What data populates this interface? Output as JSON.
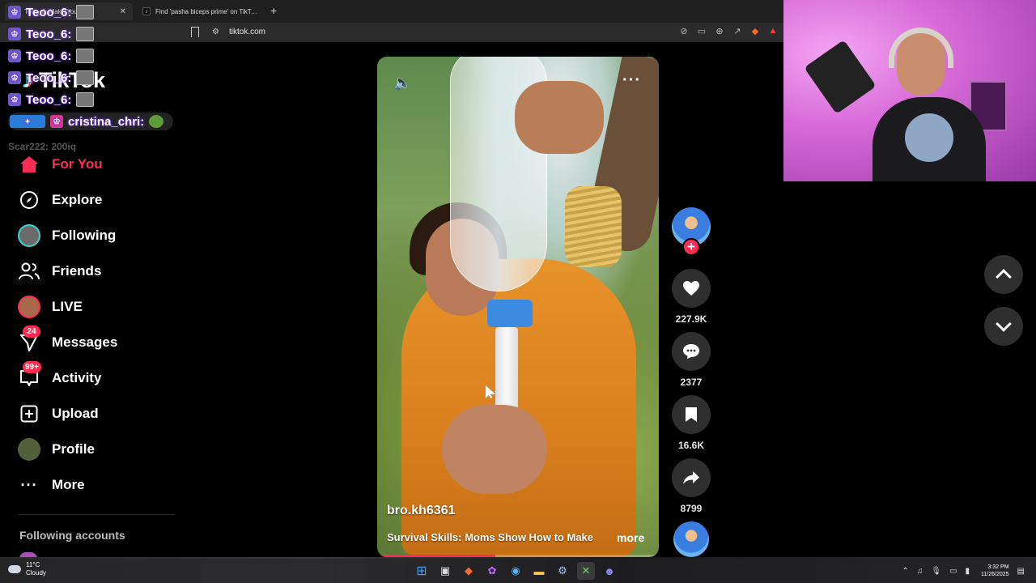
{
  "browser": {
    "tabs": [
      {
        "title": "Teoo_6: Make You...",
        "active": true
      },
      {
        "title": "Find 'pasha biceps prime' on TikTok |",
        "active": false
      }
    ],
    "url": "tiktok.com"
  },
  "app": {
    "logo_text": "TikTok"
  },
  "chat": {
    "messages": [
      {
        "user": "Teoo_6:"
      },
      {
        "user": "Teoo_6:"
      },
      {
        "user": "Teoo_6:"
      },
      {
        "user": "Teoo_6:"
      },
      {
        "user": "Teoo_6:"
      },
      {
        "user": "cristina_chri:"
      },
      {
        "user": "Scar222: 200iq"
      }
    ]
  },
  "sidebar": {
    "items": [
      {
        "label": "For You",
        "icon": "home-icon",
        "active": true
      },
      {
        "label": "Explore",
        "icon": "compass-icon"
      },
      {
        "label": "Following",
        "icon": "following-avatar"
      },
      {
        "label": "Friends",
        "icon": "friends-icon"
      },
      {
        "label": "LIVE",
        "icon": "live-avatar"
      },
      {
        "label": "Messages",
        "icon": "messages-icon",
        "badge": "24"
      },
      {
        "label": "Activity",
        "icon": "activity-icon",
        "badge": "99+"
      },
      {
        "label": "Upload",
        "icon": "upload-icon"
      },
      {
        "label": "Profile",
        "icon": "profile-avatar"
      },
      {
        "label": "More",
        "icon": "more-icon"
      }
    ],
    "following_accounts_label": "Following accounts"
  },
  "video": {
    "author": "bro.kh6361",
    "caption": "Survival Skills: Moms Show How to Make",
    "more_label": "more",
    "progress": 0.42
  },
  "actions": {
    "likes": "227.9K",
    "comments": "2377",
    "saves": "16.6K",
    "shares": "8799"
  },
  "taskbar": {
    "temperature": "11°C",
    "weather": "Cloudy",
    "time": "3:32 PM",
    "date": "11/26/2025"
  },
  "colors": {
    "accent": "#fe2c55",
    "teal": "#25f4ee"
  }
}
